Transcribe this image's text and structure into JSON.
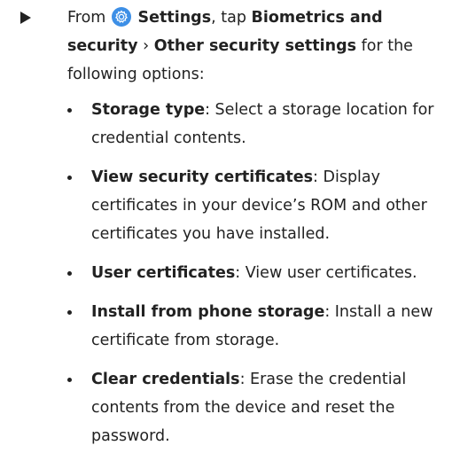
{
  "step": {
    "from_label": "From",
    "settings_label": "Settings",
    "tap_label": ", tap",
    "biometrics_label": "Biometrics and security",
    "separator": "›",
    "other_settings_label": "Other security settings",
    "suffix": "for the following options:"
  },
  "icons": {
    "step_marker": "right-triangle-icon",
    "settings": "gear-icon",
    "settings_color": "#3d8fe6"
  },
  "options": [
    {
      "title": "Storage type",
      "desc": ": Select a storage location for credential contents."
    },
    {
      "title": "View security certificates",
      "desc": ": Display certificates in your device’s ROM and other certificates you have installed."
    },
    {
      "title": "User certificates",
      "desc": ": View user certificates."
    },
    {
      "title": "Install from phone storage",
      "desc": ": Install a new certificate from storage."
    },
    {
      "title": "Clear credentials",
      "desc": ": Erase the credential contents from the device and reset the password."
    }
  ]
}
